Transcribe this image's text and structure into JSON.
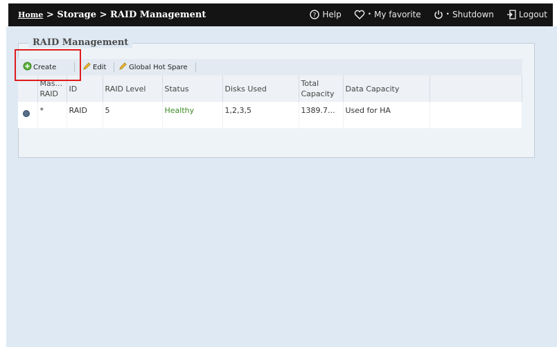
{
  "breadcrumb": {
    "home": "Home",
    "sep1": ">",
    "section": "Storage",
    "sep2": ">",
    "page": "RAID Management"
  },
  "topnav": {
    "help": "Help",
    "favorite": "My favorite",
    "shutdown": "Shutdown",
    "logout": "Logout"
  },
  "panel": {
    "title": "RAID Management"
  },
  "toolbar": {
    "create": "Create",
    "edit": "Edit",
    "global_hot_spare": "Global Hot Spare"
  },
  "table": {
    "headers": [
      "Mas... RAID",
      "ID",
      "RAID Level",
      "Status",
      "Disks Used",
      "Total Capacity",
      "Data Capacity"
    ],
    "rows": [
      {
        "master": "*",
        "id": "RAID",
        "level": "5",
        "status": "Healthy",
        "disks": "1,2,3,5",
        "total": "1389.7...",
        "data": "Used for HA"
      }
    ]
  },
  "colors": {
    "topbar": "#141414",
    "content_bg": "#dfe9f3",
    "status_ok": "#3a8a22",
    "highlight": "#e01b1b"
  }
}
